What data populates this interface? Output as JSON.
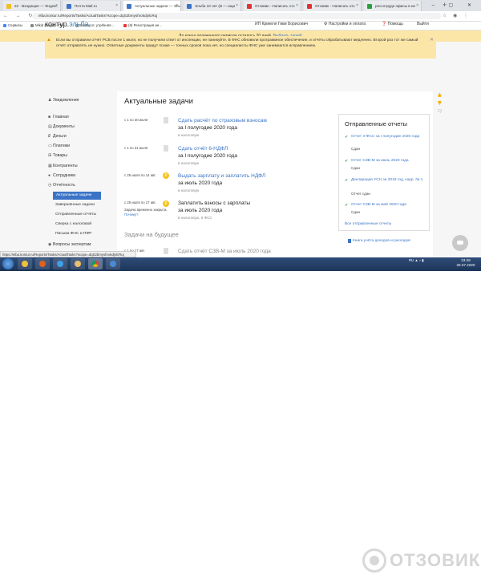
{
  "browser": {
    "tabs": [
      {
        "label": "22 · Входящие — Яндекс",
        "color": "#f0c020"
      },
      {
        "label": "Почта Mail.ru",
        "color": "#3b74c6"
      },
      {
        "label": "Актуальные задачи — Эльба",
        "color": "#3b74c6"
      },
      {
        "label": "Эльба 10 лет (В — ищи",
        "color": "#3b74c6"
      },
      {
        "label": "Отзовик - Написать отз",
        "color": "#d33"
      },
      {
        "label": "Отзовик - Написать отз",
        "color": "#d33"
      },
      {
        "label": "россотрудн офисы в ин",
        "color": "#2a9d3c"
      }
    ],
    "url": "elba.kontur.ru/Reports/Tasks/ActualTasks?scope=dqS2bmyshrokdjvlcRuj",
    "bookmarks": [
      "Сервисы",
      "Mikid (сюда) - Поч...",
      "Шахарот, утренняя...",
      "(8) Регистрация ин..."
    ]
  },
  "promo": {
    "text": "До конца оплаченного периода осталось 20 дней.",
    "link": "Выбрать тариф"
  },
  "header": {
    "logo_a": "контур.",
    "logo_b": "эльба",
    "user": "ИП Крикеля Гиви Борисович",
    "settings": "Настройки и оплата",
    "help": "Помощь",
    "logout": "Выйти"
  },
  "warning": {
    "text": "Если вы отправили отчёт РСВ после 1 июля, но не получили ответ от инспекции, не паникуйте. В ФНС обновили программное обеспечение, и отчёты обрабатывают медленно. Второй раз тот же самый отчёт отправлять не нужно. Ответные документы придут позже — точных сроков пока нет, но специалисты ФНС уже занимаются исправлением."
  },
  "sidebar": {
    "notifications": "Уведомления",
    "items": [
      "Главная",
      "Документы",
      "Деньги",
      "Платежи",
      "Товары",
      "Контрагенты",
      "Сотрудники",
      "Отчётность"
    ],
    "subitems": [
      "Актуальные задачи",
      "Завершённые задачи",
      "Отправленные отчёты",
      "Сверка с налоговой",
      "Письма ФНС и ПФР"
    ],
    "consult": "Вопросы экспертам"
  },
  "main": {
    "title": "Актуальные задачи",
    "tasks": [
      {
        "date": "с 1 по 30 июля",
        "title": "Сдать расчёт по страховым взносам",
        "sub": "за I полугодие 2020 года",
        "small": "в налоговую"
      },
      {
        "date": "с 1 по 31 июля",
        "title": "Сдать отчёт 6-НДФЛ",
        "sub": "за I полугодие 2020 года",
        "small": "в налоговую"
      },
      {
        "date": "с 25 июля по 14 авг.",
        "title": "Выдать зарплату и заплатить НДФЛ",
        "sub": "за июль 2020 года",
        "small": "в налоговую"
      },
      {
        "date": "с 25 июля по 17 авг.",
        "title": "Заплатить взносы с зарплаты",
        "sub": "за июль 2020 года",
        "small": "в налоговую, в ФСС",
        "closed": "Задача временно закрыта.",
        "closed_link": "Почему?"
      }
    ],
    "future_title": "Задачи на будущее",
    "future_date": "с 1 по 17 авг.",
    "future_task": "Сдать отчёт СЗВ-М за июль 2020 года"
  },
  "sent": {
    "title": "Отправленные отчеты",
    "reports": [
      {
        "name": "Отчет 4-ФСС за I полугодие 2020 года",
        "status": "Сдан"
      },
      {
        "name": "Отчет СЗВ-М за июнь 2020 года",
        "status": "Сдан"
      },
      {
        "name": "Декларация УСН за 2019 год, корр. № 1",
        "status": "Отчет сдан"
      },
      {
        "name": "Отчет СЗВ-М за май 2020 года",
        "status": "Сдан"
      }
    ],
    "all": "Все отправленные отчеты",
    "book": "Книга учёта доходов и расходов"
  },
  "statusbar": {
    "url": "https://elba.kontur.ru/Reports/Tasks/ActualTasks?scope=dqS2bmyshrokdjvlcRuj"
  },
  "taskbar": {
    "lang": "RU",
    "time": "23:46",
    "date": "26.07.2020"
  },
  "watermark": {
    "text": "ОТЗОВИК"
  }
}
